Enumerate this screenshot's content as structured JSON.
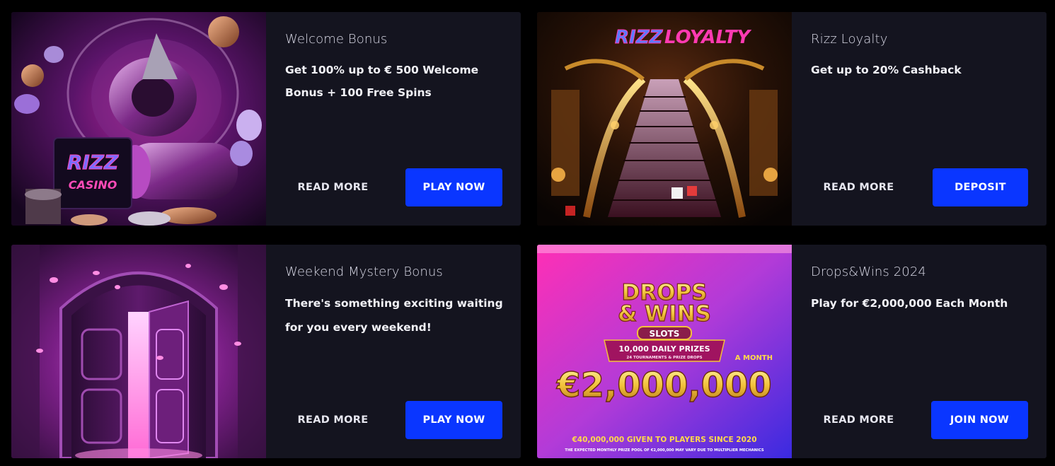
{
  "colors": {
    "page_bg": "#000000",
    "card_bg": "#14141f",
    "button_primary": "#0a36ff",
    "text_primary": "#f2f2f7",
    "text_title": "#d9d9e6"
  },
  "promotions": [
    {
      "title": "Welcome Bonus",
      "description": "Get 100% up to € 500 Welcome Bonus + 100 Free Spins",
      "read_more_label": "READ MORE",
      "action_label": "PLAY NOW",
      "image": {
        "icon": "casino-vault-artwork",
        "logo_line1": "RIZZ",
        "logo_line2": "CASINO"
      }
    },
    {
      "title": "Rizz Loyalty",
      "description": "Get up to 20% Cashback",
      "read_more_label": "READ MORE",
      "action_label": "DEPOSIT",
      "image": {
        "icon": "golden-staircase-artwork",
        "logo_part1": "RIZZ",
        "logo_part2": "LOYALTY"
      }
    },
    {
      "title": "Weekend Mystery Bonus",
      "description": "There's something exciting waiting for you every weekend!",
      "read_more_label": "READ MORE",
      "action_label": "PLAY NOW",
      "image": {
        "icon": "mystery-door-artwork"
      }
    },
    {
      "title": "Drops&Wins 2024",
      "description": "Play for €2,000,000 Each Month",
      "read_more_label": "READ MORE",
      "action_label": "JOIN NOW",
      "image": {
        "icon": "drops-wins-banner",
        "line1": "DROPS",
        "line2": "& WINS",
        "badge": "SLOTS",
        "daily_prizes": "10,000 DAILY PRIZES",
        "tournaments": "24 TOURNAMENTS & PRIZE DROPS",
        "per_period": "A MONTH",
        "amount": "€2,000,000",
        "footer1": "€40,000,000 GIVEN TO PLAYERS SINCE 2020",
        "footer2": "THE EXPECTED MONTHLY PRIZE POOL OF €2,000,000 MAY VARY DUE TO MULTIPLIER MECHANICS"
      }
    }
  ]
}
